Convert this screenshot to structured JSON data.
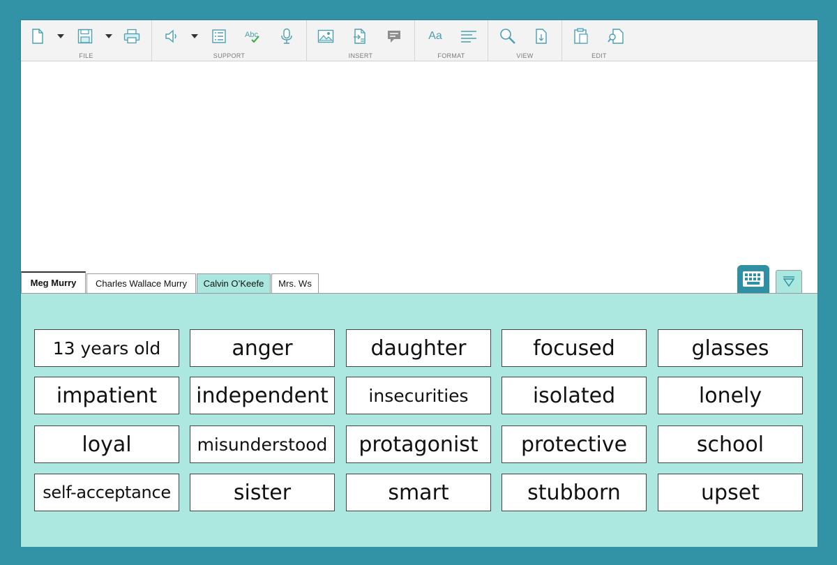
{
  "toolbar": {
    "groups": [
      {
        "label": "FILE"
      },
      {
        "label": "SUPPORT"
      },
      {
        "label": "INSERT"
      },
      {
        "label": "FORMAT"
      },
      {
        "label": "VIEW"
      },
      {
        "label": "EDIT"
      }
    ],
    "format_font_glyph": "Aa",
    "spell_glyph": "Abc"
  },
  "tabs": [
    {
      "label": "Meg Murry"
    },
    {
      "label": "Charles Wallace Murry"
    },
    {
      "label": "Calvin O’Keefe"
    },
    {
      "label": "Mrs. Ws"
    }
  ],
  "words": [
    "13 years old",
    "anger",
    "daughter",
    "focused",
    "glasses",
    "impatient",
    "independent",
    "insecurities",
    "isolated",
    "lonely",
    "loyal",
    "misunderstood",
    "protagonist",
    "protective",
    "school",
    "self-acceptance",
    "sister",
    "smart",
    "stubborn",
    "upset"
  ],
  "colors": {
    "frame": "#3393a6",
    "panel": "#ade8e0",
    "accent": "#2f8fa3",
    "icon": "#5aaab8"
  }
}
